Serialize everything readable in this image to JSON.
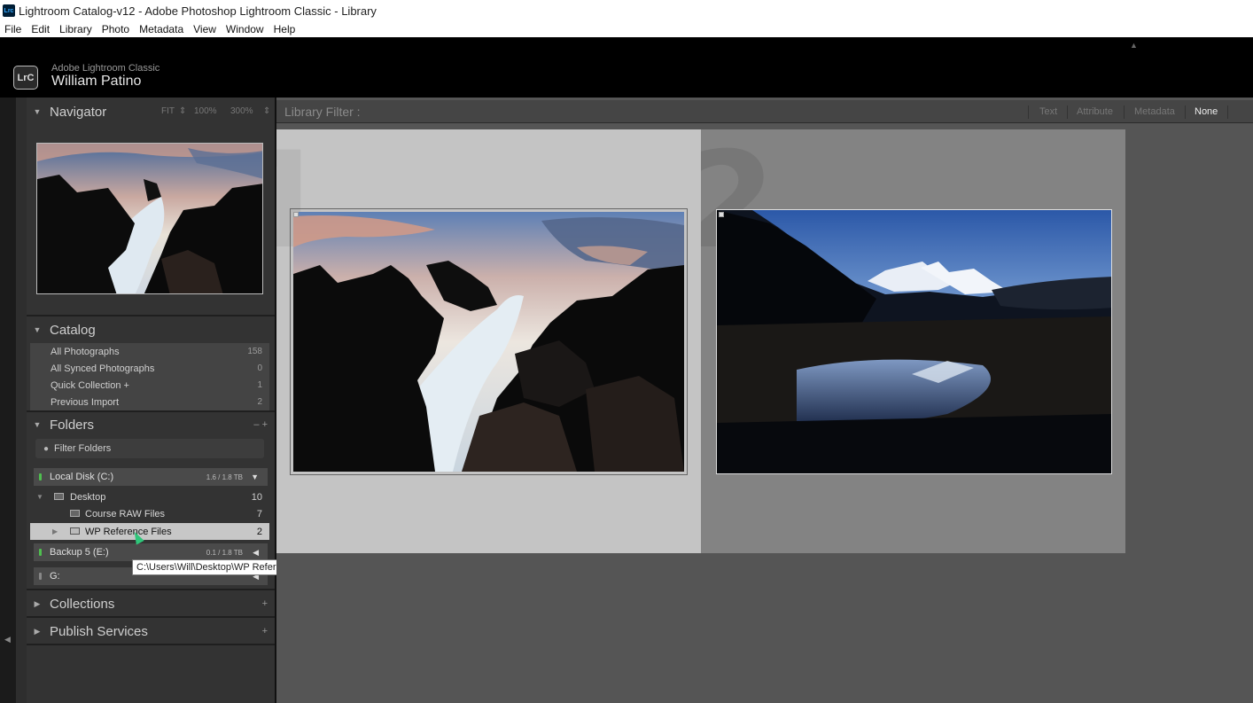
{
  "window": {
    "title": "Lightroom Catalog-v12 - Adobe Photoshop Lightroom Classic - Library",
    "app_icon": "Lrc"
  },
  "menu": [
    "File",
    "Edit",
    "Library",
    "Photo",
    "Metadata",
    "View",
    "Window",
    "Help"
  ],
  "identity": {
    "badge": "LrC",
    "product": "Adobe Lightroom Classic",
    "user": "William Patino"
  },
  "navigator": {
    "title": "Navigator",
    "fit": "FIT",
    "zoom1": "100%",
    "zoom2": "300%"
  },
  "catalog": {
    "title": "Catalog",
    "items": [
      {
        "label": "All Photographs",
        "count": "158"
      },
      {
        "label": "All Synced Photographs",
        "count": "0"
      },
      {
        "label": "Quick Collection  +",
        "count": "1"
      },
      {
        "label": "Previous Import",
        "count": "2"
      }
    ]
  },
  "folders": {
    "title": "Folders",
    "filter_placeholder": "Filter Folders",
    "volumes": [
      {
        "name": "Local Disk (C:)",
        "capacity": "1.6 / 1.8 TB"
      },
      {
        "name": "Backup 5 (E:)",
        "capacity": "0.1 / 1.8 TB"
      },
      {
        "name": "G:",
        "capacity": ""
      }
    ],
    "tree": [
      {
        "label": "Desktop",
        "count": "10"
      },
      {
        "label": "Course RAW Files",
        "count": "7"
      },
      {
        "label": "WP Reference Files",
        "count": "2"
      }
    ],
    "tooltip": "C:\\Users\\Will\\Desktop\\WP Reference Files"
  },
  "collections": {
    "title": "Collections"
  },
  "publish": {
    "title": "Publish Services"
  },
  "library_filter": {
    "label": "Library Filter :",
    "options": [
      "Text",
      "Attribute",
      "Metadata",
      "None"
    ],
    "active": "None"
  },
  "grid": {
    "cells": [
      {
        "index": "1"
      },
      {
        "index": "2"
      }
    ]
  }
}
